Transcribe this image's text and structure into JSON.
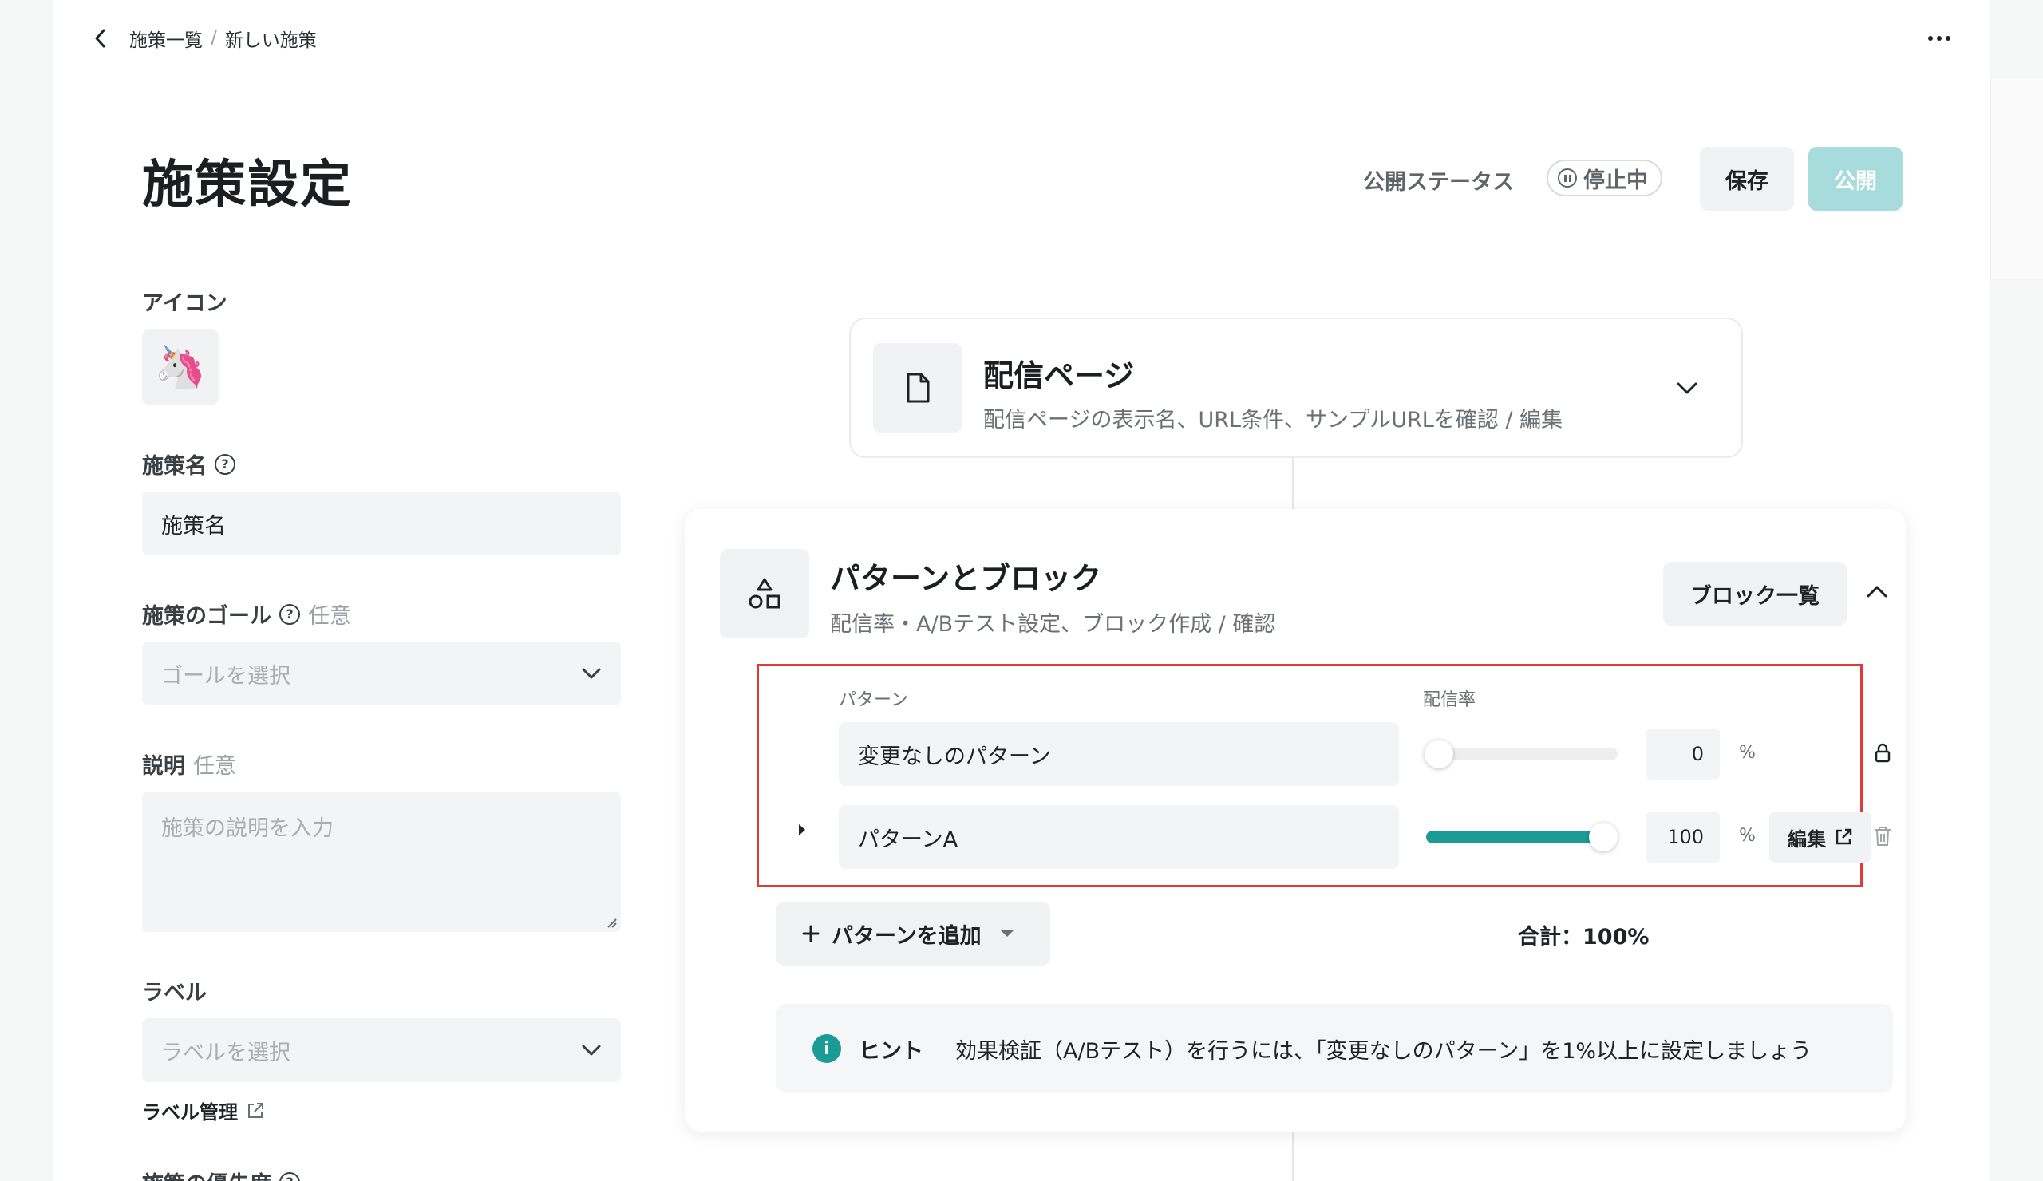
{
  "breadcrumb": {
    "parent": "施策一覧",
    "separator": "/",
    "current": "新しい施策"
  },
  "header": {
    "title": "施策設定",
    "status_label": "公開ステータス",
    "status_value": "停止中",
    "save_label": "保存",
    "publish_label": "公開"
  },
  "form": {
    "icon_label": "アイコン",
    "icon_emoji": "🦄",
    "name_label": "施策名",
    "name_value": "施策名",
    "goal_label": "施策のゴール",
    "goal_optional": "任意",
    "goal_placeholder": "ゴールを選択",
    "desc_label": "説明",
    "desc_optional": "任意",
    "desc_placeholder": "施策の説明を入力",
    "label_label": "ラベル",
    "label_placeholder": "ラベルを選択",
    "label_manage": "ラベル管理",
    "priority_label": "施策の優先度"
  },
  "delivery_card": {
    "title": "配信ページ",
    "subtitle": "配信ページの表示名、URL条件、サンプルURLを確認 / 編集"
  },
  "pattern_card": {
    "title": "パターンとブロック",
    "subtitle": "配信率・A/Bテスト設定、ブロック作成 / 確認",
    "block_list_label": "ブロック一覧",
    "col_pattern": "パターン",
    "col_rate": "配信率",
    "patterns": [
      {
        "name": "変更なしのパターン",
        "rate": "0",
        "unit": "%",
        "rate_fraction": 0.0
      },
      {
        "name": "パターンA",
        "rate": "100",
        "unit": "%",
        "rate_fraction": 1.0,
        "edit_label": "編集"
      }
    ],
    "add_label": "パターンを追加",
    "total": "合計：100%",
    "hint_title": "ヒント",
    "hint_text": "効果検証（A/Bテスト）を行うには、「変更なしのパターン」を1%以上に設定しましょう"
  },
  "colors": {
    "accent": "#1a9b96",
    "publish_disabled": "#a8dcdc",
    "highlight_border": "#e53935"
  },
  "icons": [
    "chevron-left-icon",
    "more-icon",
    "pause-icon",
    "help-icon",
    "chevron-down-icon",
    "document-icon",
    "shapes-icon",
    "chevron-up-icon",
    "caret-right-icon",
    "lock-icon",
    "external-link-icon",
    "trash-icon",
    "plus-icon",
    "caret-down-icon",
    "info-icon",
    "resize-grip-icon"
  ]
}
